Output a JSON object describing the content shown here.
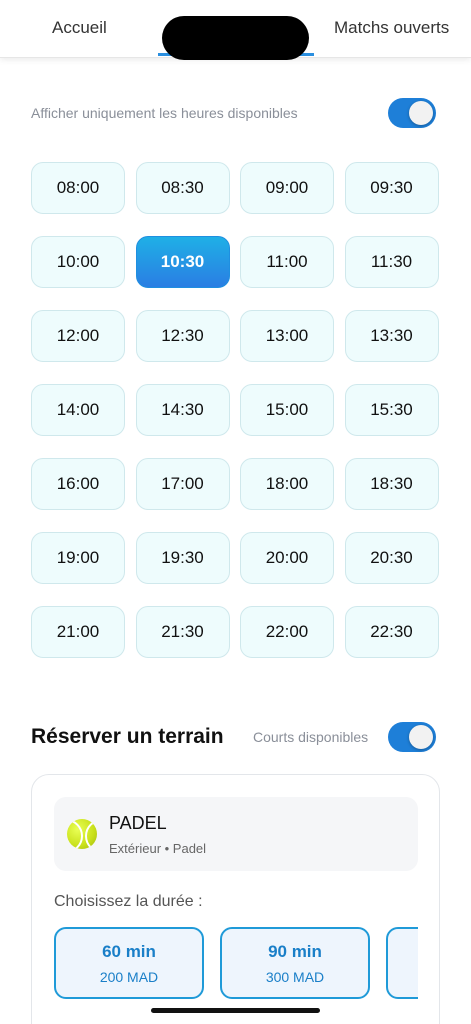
{
  "tabs": {
    "home": "Accueil",
    "open_matches": "Matchs ouverts"
  },
  "filter": {
    "label": "Afficher uniquement les heures disponibles",
    "enabled": true
  },
  "slots": [
    "08:00",
    "08:30",
    "09:00",
    "09:30",
    "10:00",
    "10:30",
    "11:00",
    "11:30",
    "12:00",
    "12:30",
    "13:00",
    "13:30",
    "14:00",
    "14:30",
    "15:00",
    "15:30",
    "16:00",
    "17:00",
    "18:00",
    "18:30",
    "19:00",
    "19:30",
    "20:00",
    "20:30",
    "21:00",
    "21:30",
    "22:00",
    "22:30"
  ],
  "selected_slot": "10:30",
  "reserve": {
    "title": "Réserver un terrain",
    "courts_label": "Courts disponibles",
    "courts_enabled": true
  },
  "court": {
    "icon": "tennis-ball-icon",
    "name": "PADEL",
    "meta": "Extérieur • Padel"
  },
  "duration": {
    "label": "Choisissez la durée :",
    "options": [
      {
        "label": "60 min",
        "price": "200 MAD"
      },
      {
        "label": "90 min",
        "price": "300 MAD"
      }
    ]
  },
  "colors": {
    "accent": "#1e7fd8",
    "slot_bg": "#eefcfd",
    "selected_from": "#1fb0e6",
    "selected_to": "#2a7ee3"
  }
}
